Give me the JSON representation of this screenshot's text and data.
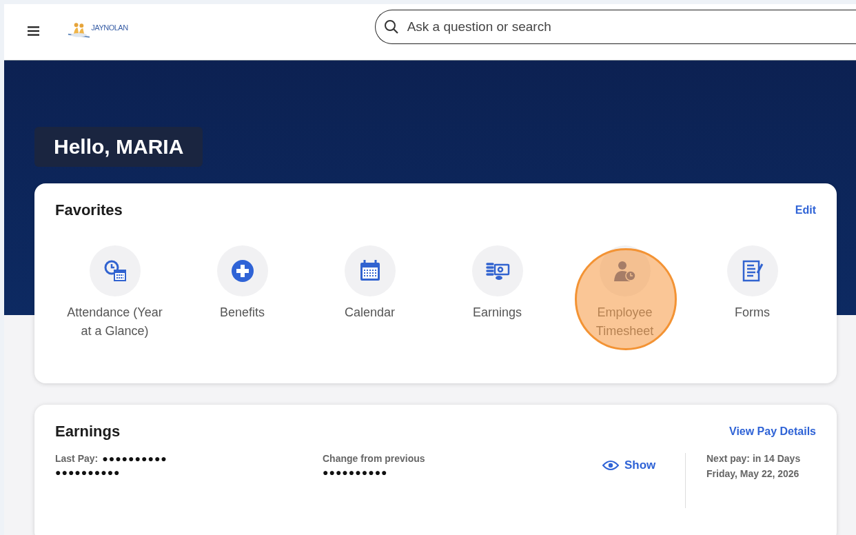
{
  "header": {
    "logo_text": "JAYNOLAN",
    "search": {
      "placeholder": "Ask a question or search"
    }
  },
  "greeting": "Hello, MARIA",
  "favorites": {
    "title": "Favorites",
    "edit": "Edit",
    "items": [
      {
        "label": "Attendance (Year at a Glance)",
        "kind": "attendance",
        "highlighted": false
      },
      {
        "label": "Benefits",
        "kind": "benefits",
        "highlighted": false
      },
      {
        "label": "Calendar",
        "kind": "calendar",
        "highlighted": false
      },
      {
        "label": "Earnings",
        "kind": "earnings",
        "highlighted": false
      },
      {
        "label": "Employee Timesheet",
        "kind": "timesheet",
        "highlighted": true
      },
      {
        "label": "Forms",
        "kind": "forms",
        "highlighted": false
      }
    ]
  },
  "earnings": {
    "title": "Earnings",
    "link": "View Pay Details",
    "last_pay_label": "Last Pay:",
    "last_pay_value": "●●●●●●●●●●",
    "last_pay_value_2": "●●●●●●●●●●",
    "change_label": "Change from previous",
    "change_value": "●●●●●●●●●●",
    "show": "Show",
    "next_pay": "Next pay: in 14 Days",
    "next_pay_date": "Friday, May 22, 2026"
  }
}
